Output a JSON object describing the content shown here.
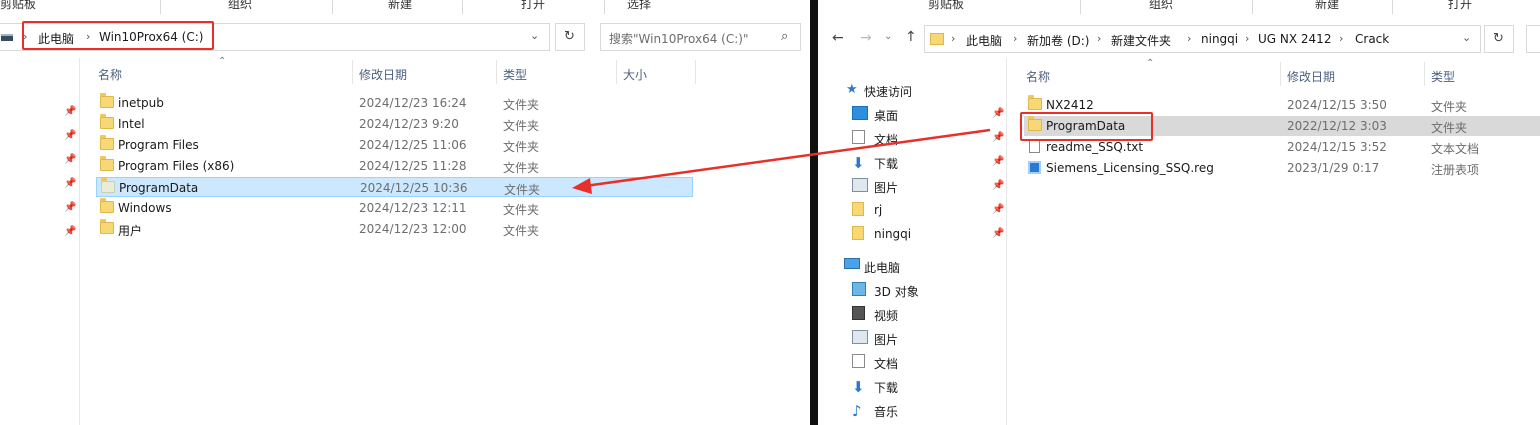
{
  "left": {
    "ribbon": [
      "剪贴板",
      "组织",
      "新建",
      "打开",
      "选择"
    ],
    "path": [
      "此电脑",
      "Win10Prox64 (C:)"
    ],
    "search_placeholder": "搜索\"Win10Prox64 (C:)\"",
    "columns": [
      "名称",
      "修改日期",
      "类型",
      "大小"
    ],
    "rows": [
      {
        "name": "inetpub",
        "date": "2024/12/23 16:24",
        "type": "文件夹"
      },
      {
        "name": "Intel",
        "date": "2024/12/23 9:20",
        "type": "文件夹"
      },
      {
        "name": "Program Files",
        "date": "2024/12/25 11:06",
        "type": "文件夹"
      },
      {
        "name": "Program Files (x86)",
        "date": "2024/12/25 11:28",
        "type": "文件夹"
      },
      {
        "name": "ProgramData",
        "date": "2024/12/25 10:36",
        "type": "文件夹"
      },
      {
        "name": "Windows",
        "date": "2024/12/23 12:11",
        "type": "文件夹"
      },
      {
        "name": "用户",
        "date": "2024/12/23 12:00",
        "type": "文件夹"
      }
    ]
  },
  "right": {
    "ribbon": [
      "剪贴板",
      "组织",
      "新建",
      "打开"
    ],
    "path": [
      "此电脑",
      "新加卷 (D:)",
      "新建文件夹",
      "ningqi",
      "UG NX 2412",
      "Crack"
    ],
    "columns": [
      "名称",
      "修改日期",
      "类型"
    ],
    "nav": {
      "quick_access": "快速访问",
      "pinned": [
        "桌面",
        "文档",
        "下载",
        "图片",
        "rj",
        "ningqi"
      ],
      "this_pc": "此电脑",
      "pc_items": [
        "3D 对象",
        "视频",
        "图片",
        "文档",
        "下载",
        "音乐"
      ]
    },
    "rows": [
      {
        "name": "NX2412",
        "date": "2024/12/15 3:50",
        "type": "文件夹",
        "icon": "folder-icon"
      },
      {
        "name": "ProgramData",
        "date": "2022/12/12 3:03",
        "type": "文件夹",
        "icon": "folder-icon"
      },
      {
        "name": "readme_SSQ.txt",
        "date": "2024/12/15 3:52",
        "type": "文本文档",
        "icon": "text-file-icon"
      },
      {
        "name": "Siemens_Licensing_SSQ.reg",
        "date": "2023/1/29 0:17",
        "type": "注册表项",
        "icon": "registry-icon"
      }
    ]
  },
  "colors": {
    "highlight": "#e8302a",
    "selected_row": "#cce8ff",
    "selected_border": "#99d1ff"
  }
}
